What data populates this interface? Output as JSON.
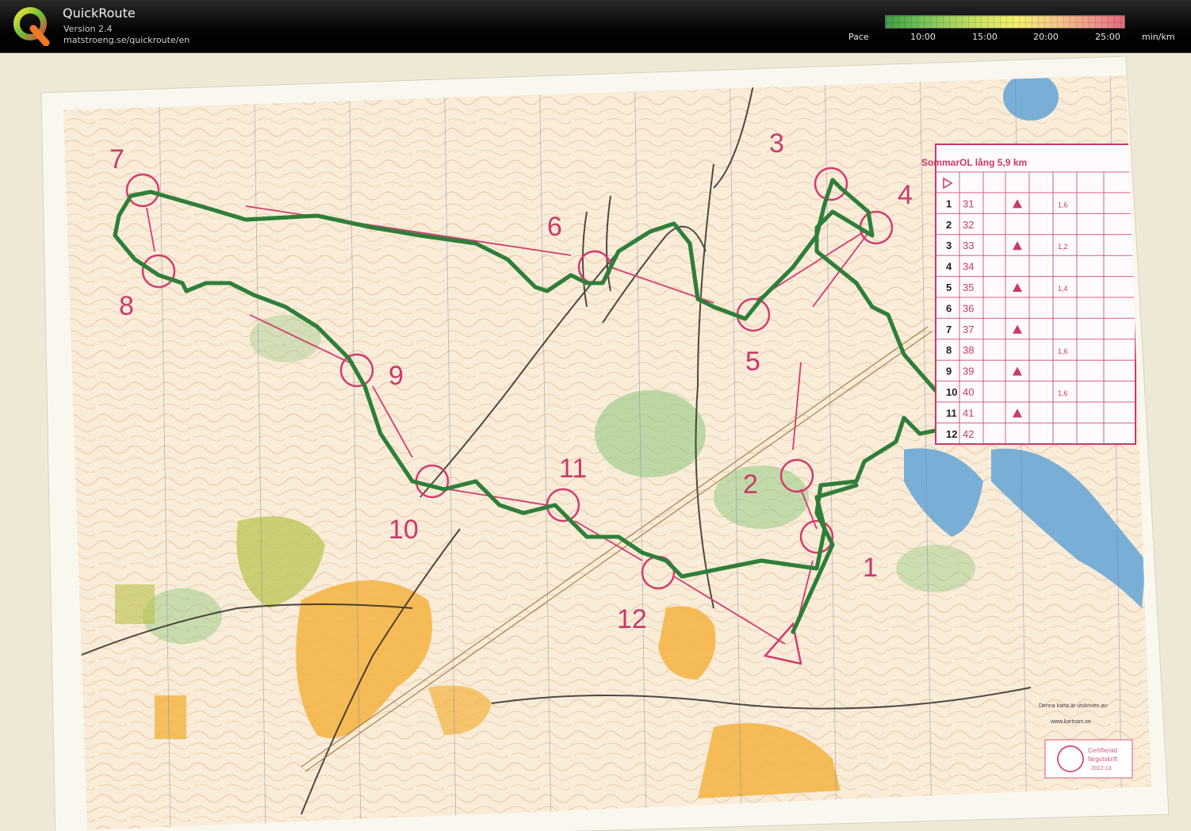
{
  "app": {
    "title": "QuickRoute",
    "version": "Version 2.4",
    "url": "matstroeng.se/quickroute/en",
    "logo_icon": "quickroute-q-logo-icon"
  },
  "pace_legend": {
    "label": "Pace",
    "ticks": [
      "10:00",
      "15:00",
      "20:00",
      "25:00"
    ],
    "unit": "min/km",
    "colors": [
      "#3f9d45",
      "#78c35a",
      "#c2df63",
      "#f6ee70",
      "#f3c88b",
      "#ee8d8a",
      "#e56b7a"
    ]
  },
  "map": {
    "control_numbers": [
      "1",
      "2",
      "3",
      "4",
      "5",
      "6",
      "7",
      "8",
      "9",
      "10",
      "11",
      "12"
    ],
    "description_table": {
      "title": "SommarOL lång 5,9 km",
      "rows": [
        {
          "num": "1",
          "code": "31",
          "dist": "1,6"
        },
        {
          "num": "2",
          "code": "32",
          "dist": ""
        },
        {
          "num": "3",
          "code": "33",
          "dist": "1,2"
        },
        {
          "num": "4",
          "code": "34",
          "dist": ""
        },
        {
          "num": "5",
          "code": "35",
          "dist": "1,4"
        },
        {
          "num": "6",
          "code": "36",
          "dist": ""
        },
        {
          "num": "7",
          "code": "37",
          "dist": ""
        },
        {
          "num": "8",
          "code": "38",
          "dist": "1,6"
        },
        {
          "num": "9",
          "code": "39",
          "dist": ""
        },
        {
          "num": "10",
          "code": "40",
          "dist": "1,6"
        },
        {
          "num": "11",
          "code": "41",
          "dist": ""
        },
        {
          "num": "12",
          "code": "42",
          "dist": ""
        }
      ]
    },
    "footer_note": "Denna karta är utskriven av:",
    "website": "www.kartsam.se",
    "cert_line1": "Certifierad",
    "cert_line2": "färgutskrift",
    "cert_year": "2012-13",
    "colors": {
      "course": "#d23c6e",
      "route_outer": "#2f7f3a",
      "route_inner": "#e8e860",
      "water": "#6aa9d6",
      "forest_open": "#f4b340",
      "green": "#8cc77a"
    }
  }
}
